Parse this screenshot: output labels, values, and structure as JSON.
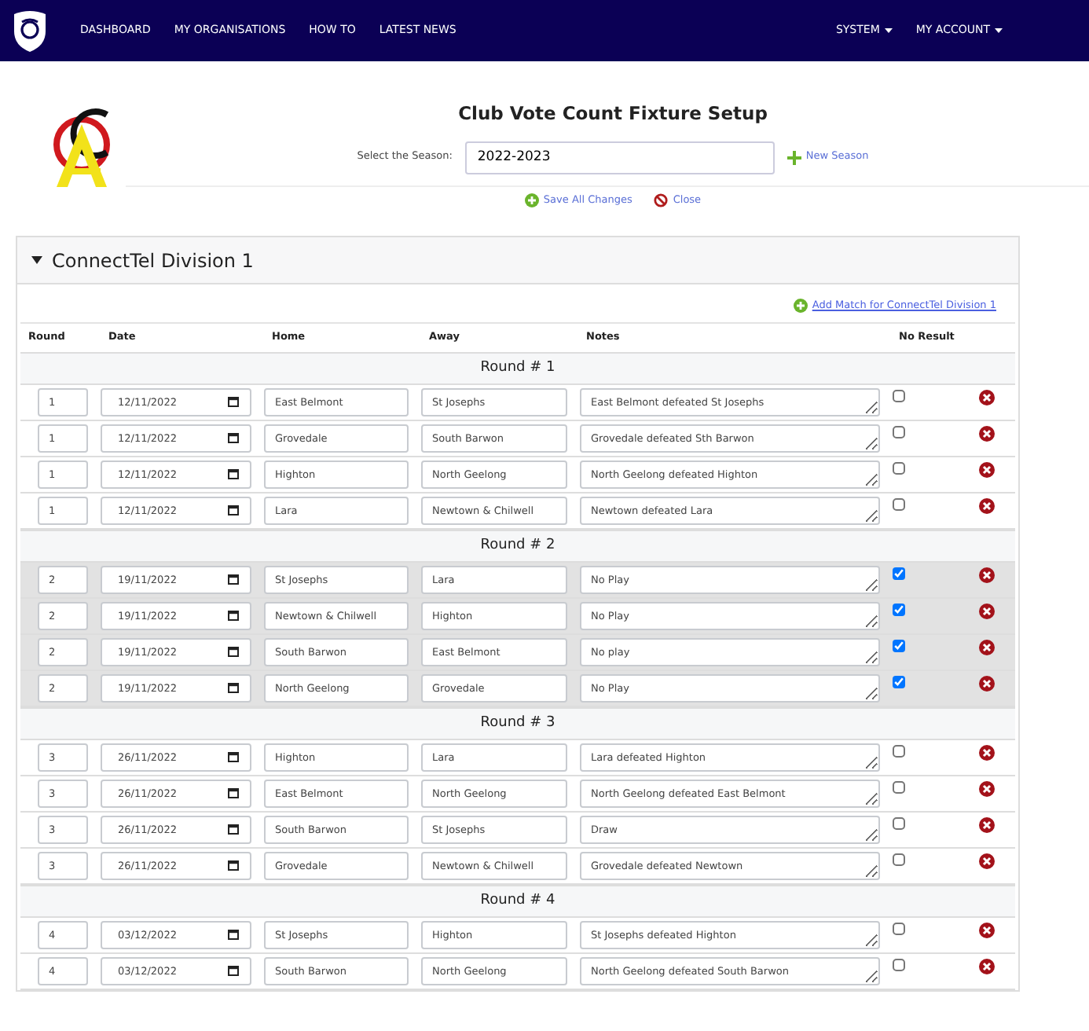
{
  "navbar": {
    "links": [
      {
        "label": "DASHBOARD"
      },
      {
        "label": "MY ORGANISATIONS"
      },
      {
        "label": "HOW TO"
      },
      {
        "label": "LATEST NEWS"
      }
    ],
    "menus": [
      {
        "label": "SYSTEM"
      },
      {
        "label": "MY ACCOUNT"
      }
    ]
  },
  "page": {
    "title": "Club Vote Count Fixture Setup",
    "season_label": "Select the Season:",
    "season": "2022-2023",
    "new_season": "New Season",
    "save": "Save All Changes",
    "close": "Close"
  },
  "division": {
    "title": "ConnectTel Division 1",
    "expanded": true,
    "add_match": "Add Match for ConnectTel Division 1",
    "columns": [
      "Round",
      "Date",
      "Home",
      "Away",
      "Notes",
      "No Result"
    ],
    "rounds": [
      {
        "title": "Round # 1",
        "matches": [
          {
            "round": "1",
            "date": "12/11/2022",
            "home": "East Belmont",
            "away": "St Josephs",
            "notes": "East Belmont defeated St Josephs",
            "no_result": false
          },
          {
            "round": "1",
            "date": "12/11/2022",
            "home": "Grovedale",
            "away": "South Barwon",
            "notes": "Grovedale defeated Sth Barwon",
            "no_result": false
          },
          {
            "round": "1",
            "date": "12/11/2022",
            "home": "Highton",
            "away": "North Geelong",
            "notes": "North Geelong defeated Highton",
            "no_result": false
          },
          {
            "round": "1",
            "date": "12/11/2022",
            "home": "Lara",
            "away": "Newtown & Chilwell",
            "notes": "Newtown defeated Lara",
            "no_result": false
          }
        ]
      },
      {
        "title": "Round # 2",
        "matches": [
          {
            "round": "2",
            "date": "19/11/2022",
            "home": "St Josephs",
            "away": "Lara",
            "notes": "No Play",
            "no_result": true
          },
          {
            "round": "2",
            "date": "19/11/2022",
            "home": "Newtown & Chilwell",
            "away": "Highton",
            "notes": "No Play",
            "no_result": true
          },
          {
            "round": "2",
            "date": "19/11/2022",
            "home": "South Barwon",
            "away": "East Belmont",
            "notes": "No play",
            "no_result": true
          },
          {
            "round": "2",
            "date": "19/11/2022",
            "home": "North Geelong",
            "away": "Grovedale",
            "notes": "No Play",
            "no_result": true
          }
        ]
      },
      {
        "title": "Round # 3",
        "matches": [
          {
            "round": "3",
            "date": "26/11/2022",
            "home": "Highton",
            "away": "Lara",
            "notes": "Lara defeated Highton",
            "no_result": false
          },
          {
            "round": "3",
            "date": "26/11/2022",
            "home": "East Belmont",
            "away": "North Geelong",
            "notes": "North Geelong defeated East Belmont",
            "no_result": false
          },
          {
            "round": "3",
            "date": "26/11/2022",
            "home": "South Barwon",
            "away": "St Josephs",
            "notes": "Draw",
            "no_result": false
          },
          {
            "round": "3",
            "date": "26/11/2022",
            "home": "Grovedale",
            "away": "Newtown & Chilwell",
            "notes": "Grovedale defeated Newtown",
            "no_result": false
          }
        ]
      },
      {
        "title": "Round # 4",
        "matches": [
          {
            "round": "4",
            "date": "03/12/2022",
            "home": "St Josephs",
            "away": "Highton",
            "notes": "St Josephs defeated Highton",
            "no_result": false
          },
          {
            "round": "4",
            "date": "03/12/2022",
            "home": "South Barwon",
            "away": "North Geelong",
            "notes": "North Geelong defeated South Barwon",
            "no_result": false
          }
        ]
      }
    ]
  }
}
